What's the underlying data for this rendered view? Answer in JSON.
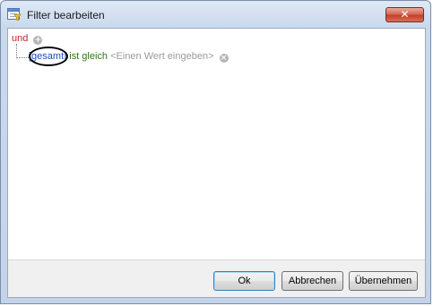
{
  "window": {
    "title": "Filter bearbeiten",
    "close_label": "✕"
  },
  "filter": {
    "operator": "und",
    "condition": {
      "field": "[gesamt]",
      "comparison": "ist gleich",
      "value_placeholder": "<Einen Wert eingeben>"
    }
  },
  "buttons": {
    "ok": "Ok",
    "cancel": "Abbrechen",
    "apply": "Übernehmen"
  },
  "colors": {
    "operator": "#c0282d",
    "field": "#1b4fb5",
    "comparison": "#2c7a12",
    "placeholder": "#9a9a9a"
  }
}
